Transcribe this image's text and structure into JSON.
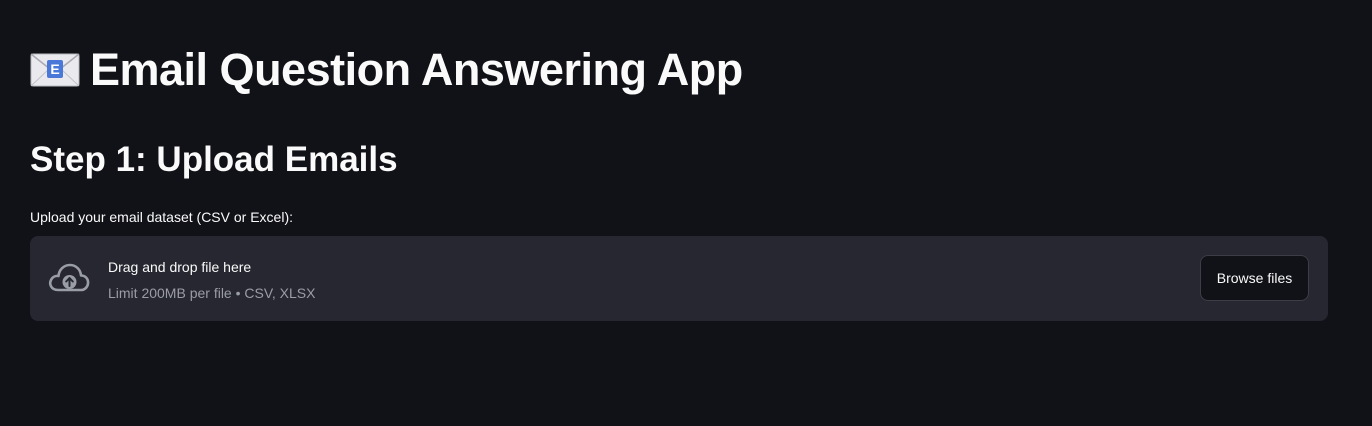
{
  "header": {
    "icon": "envelope-e-icon",
    "title": "Email Question Answering App"
  },
  "step1": {
    "heading": "Step 1: Upload Emails",
    "uploader_label": "Upload your email dataset (CSV or Excel):",
    "dropzone": {
      "icon": "cloud-upload-icon",
      "main_text": "Drag and drop file here",
      "sub_text": "Limit 200MB per file • CSV, XLSX",
      "button_label": "Browse files"
    }
  },
  "colors": {
    "background": "#111217",
    "dropzone_background": "#262730",
    "text": "#fafafa",
    "muted_text": "#9a9ca6"
  }
}
